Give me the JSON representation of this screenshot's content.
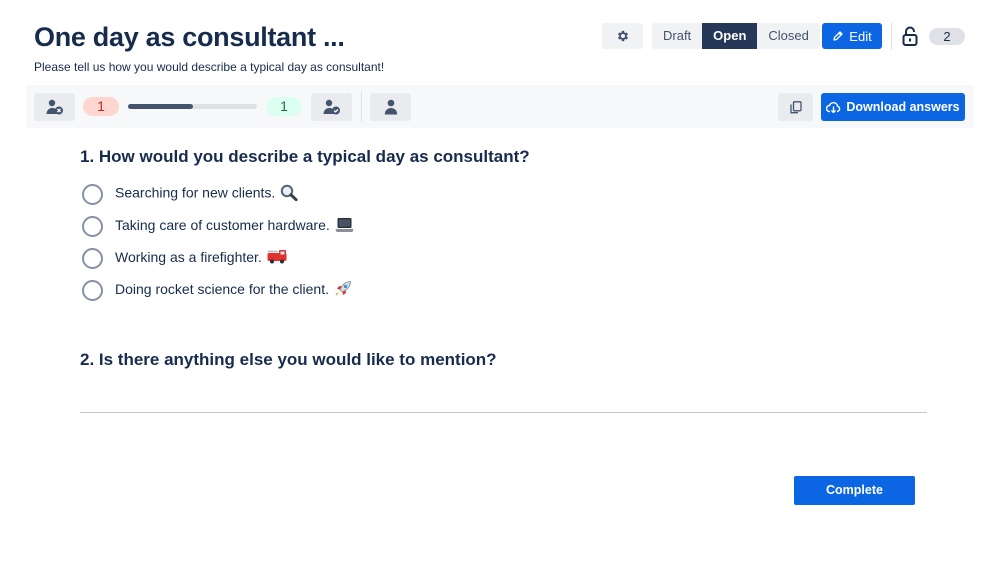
{
  "header": {
    "title": "One day as consultant ...",
    "subtitle": "Please tell us how you would describe a typical day as consultant!",
    "status_options": [
      "Draft",
      "Open",
      "Closed"
    ],
    "active_status": "Open",
    "edit_label": "Edit",
    "count": "2"
  },
  "toolbar": {
    "incomplete_count": "1",
    "complete_count": "1",
    "progress_fraction": 0.5,
    "download_label": "Download answers"
  },
  "questions": [
    {
      "title": "1. How would you describe a typical day as consultant?",
      "options": [
        {
          "label": "Searching for new clients.",
          "icon": "magnifying-glass-emoji"
        },
        {
          "label": "Taking care of customer hardware.",
          "icon": "laptop-emoji"
        },
        {
          "label": "Working as a firefighter.",
          "icon": "fire-engine-emoji"
        },
        {
          "label": "Doing rocket science for the client.",
          "icon": "rocket-emoji"
        }
      ]
    },
    {
      "title": "2. Is there anything else you would like to mention?",
      "answer_value": ""
    }
  ],
  "footer": {
    "complete_label": "Complete"
  },
  "colors": {
    "primary": "#0c66e4",
    "active_status_bg": "#253858",
    "incomplete_pill": "#ffd5d2",
    "complete_pill": "#dcfff1"
  }
}
